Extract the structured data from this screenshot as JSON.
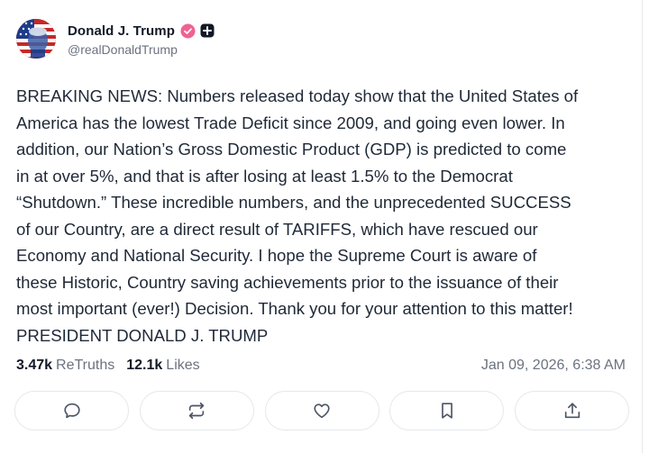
{
  "post": {
    "author": {
      "display_name": "Donald J. Trump",
      "handle": "@realDonaldTrump",
      "verified_badge_color": "#f06292",
      "verified_icon": "verified-check-icon",
      "plus_icon": "plus-badge-icon"
    },
    "text": "BREAKING NEWS: Numbers released today show that the United States of\nAmerica has the lowest Trade Deficit since 2009, and going even lower. In\naddition, our Nation’s Gross Domestic Product (GDP) is predicted to come\nin at over 5%, and that is after losing at least 1.5% to the Democrat\n“Shutdown.” These incredible numbers, and the unprecedented SUCCESS\nof our Country, are a direct result of TARIFFS, which have rescued our\nEconomy and National Security. I hope the Supreme Court is aware of\nthese Historic, Country saving achievements prior to the issuance of their\nmost important (ever!) Decision. Thank you for your attention to this matter!\nPRESIDENT DONALD J. TRUMP",
    "stats": {
      "retruths_count": "3.47k",
      "retruths_label": "ReTruths",
      "likes_count": "12.1k",
      "likes_label": "Likes"
    },
    "timestamp": "Jan 09, 2026, 6:38 AM"
  },
  "actions": [
    {
      "name": "reply",
      "icon": "comment-bubble-icon"
    },
    {
      "name": "retruth",
      "icon": "repost-arrows-icon"
    },
    {
      "name": "like",
      "icon": "heart-icon"
    },
    {
      "name": "bookmark",
      "icon": "bookmark-icon"
    },
    {
      "name": "share",
      "icon": "share-upload-icon"
    }
  ],
  "colors": {
    "text_primary": "#1f2937",
    "text_secondary": "#6b7280",
    "border": "#e5e7eb"
  }
}
